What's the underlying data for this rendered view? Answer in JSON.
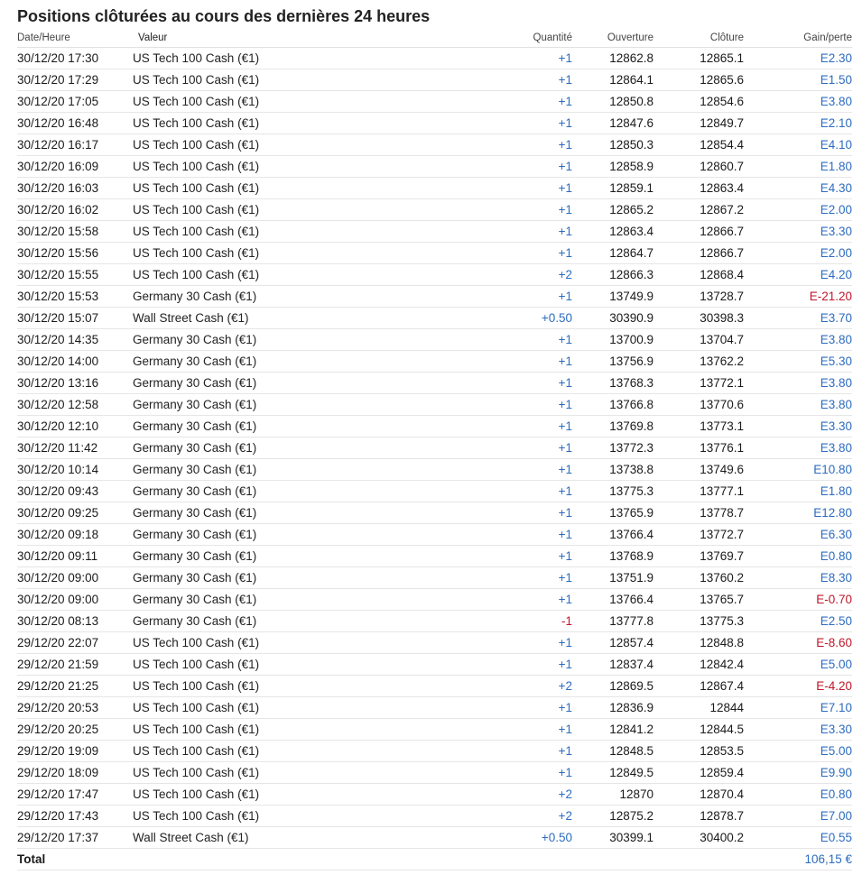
{
  "title": "Positions clôturées au cours des dernières 24 heures",
  "headers": {
    "date": "Date/Heure",
    "instrument": "Valeur",
    "quantity": "Quantité",
    "open": "Ouverture",
    "close": "Clôture",
    "pl": "Gain/perte"
  },
  "rows": [
    {
      "date": "30/12/20 17:30",
      "instrument": "US Tech 100 Cash (€1)",
      "quantity": "+1",
      "open": "12862.8",
      "close": "12865.1",
      "pl": "E2.30"
    },
    {
      "date": "30/12/20 17:29",
      "instrument": "US Tech 100 Cash (€1)",
      "quantity": "+1",
      "open": "12864.1",
      "close": "12865.6",
      "pl": "E1.50"
    },
    {
      "date": "30/12/20 17:05",
      "instrument": "US Tech 100 Cash (€1)",
      "quantity": "+1",
      "open": "12850.8",
      "close": "12854.6",
      "pl": "E3.80"
    },
    {
      "date": "30/12/20 16:48",
      "instrument": "US Tech 100 Cash (€1)",
      "quantity": "+1",
      "open": "12847.6",
      "close": "12849.7",
      "pl": "E2.10"
    },
    {
      "date": "30/12/20 16:17",
      "instrument": "US Tech 100 Cash (€1)",
      "quantity": "+1",
      "open": "12850.3",
      "close": "12854.4",
      "pl": "E4.10"
    },
    {
      "date": "30/12/20 16:09",
      "instrument": "US Tech 100 Cash (€1)",
      "quantity": "+1",
      "open": "12858.9",
      "close": "12860.7",
      "pl": "E1.80"
    },
    {
      "date": "30/12/20 16:03",
      "instrument": "US Tech 100 Cash (€1)",
      "quantity": "+1",
      "open": "12859.1",
      "close": "12863.4",
      "pl": "E4.30"
    },
    {
      "date": "30/12/20 16:02",
      "instrument": "US Tech 100 Cash (€1)",
      "quantity": "+1",
      "open": "12865.2",
      "close": "12867.2",
      "pl": "E2.00"
    },
    {
      "date": "30/12/20 15:58",
      "instrument": "US Tech 100 Cash (€1)",
      "quantity": "+1",
      "open": "12863.4",
      "close": "12866.7",
      "pl": "E3.30"
    },
    {
      "date": "30/12/20 15:56",
      "instrument": "US Tech 100 Cash (€1)",
      "quantity": "+1",
      "open": "12864.7",
      "close": "12866.7",
      "pl": "E2.00"
    },
    {
      "date": "30/12/20 15:55",
      "instrument": "US Tech 100 Cash (€1)",
      "quantity": "+2",
      "open": "12866.3",
      "close": "12868.4",
      "pl": "E4.20"
    },
    {
      "date": "30/12/20 15:53",
      "instrument": "Germany 30 Cash (€1)",
      "quantity": "+1",
      "open": "13749.9",
      "close": "13728.7",
      "pl": "E-21.20",
      "pl_negative": true
    },
    {
      "date": "30/12/20 15:07",
      "instrument": "Wall Street Cash (€1)",
      "quantity": "+0.50",
      "open": "30390.9",
      "close": "30398.3",
      "pl": "E3.70"
    },
    {
      "date": "30/12/20 14:35",
      "instrument": "Germany 30 Cash (€1)",
      "quantity": "+1",
      "open": "13700.9",
      "close": "13704.7",
      "pl": "E3.80"
    },
    {
      "date": "30/12/20 14:00",
      "instrument": "Germany 30 Cash (€1)",
      "quantity": "+1",
      "open": "13756.9",
      "close": "13762.2",
      "pl": "E5.30"
    },
    {
      "date": "30/12/20 13:16",
      "instrument": "Germany 30 Cash (€1)",
      "quantity": "+1",
      "open": "13768.3",
      "close": "13772.1",
      "pl": "E3.80"
    },
    {
      "date": "30/12/20 12:58",
      "instrument": "Germany 30 Cash (€1)",
      "quantity": "+1",
      "open": "13766.8",
      "close": "13770.6",
      "pl": "E3.80"
    },
    {
      "date": "30/12/20 12:10",
      "instrument": "Germany 30 Cash (€1)",
      "quantity": "+1",
      "open": "13769.8",
      "close": "13773.1",
      "pl": "E3.30"
    },
    {
      "date": "30/12/20 11:42",
      "instrument": "Germany 30 Cash (€1)",
      "quantity": "+1",
      "open": "13772.3",
      "close": "13776.1",
      "pl": "E3.80"
    },
    {
      "date": "30/12/20 10:14",
      "instrument": "Germany 30 Cash (€1)",
      "quantity": "+1",
      "open": "13738.8",
      "close": "13749.6",
      "pl": "E10.80"
    },
    {
      "date": "30/12/20 09:43",
      "instrument": "Germany 30 Cash (€1)",
      "quantity": "+1",
      "open": "13775.3",
      "close": "13777.1",
      "pl": "E1.80"
    },
    {
      "date": "30/12/20 09:25",
      "instrument": "Germany 30 Cash (€1)",
      "quantity": "+1",
      "open": "13765.9",
      "close": "13778.7",
      "pl": "E12.80"
    },
    {
      "date": "30/12/20 09:18",
      "instrument": "Germany 30 Cash (€1)",
      "quantity": "+1",
      "open": "13766.4",
      "close": "13772.7",
      "pl": "E6.30"
    },
    {
      "date": "30/12/20 09:11",
      "instrument": "Germany 30 Cash (€1)",
      "quantity": "+1",
      "open": "13768.9",
      "close": "13769.7",
      "pl": "E0.80"
    },
    {
      "date": "30/12/20 09:00",
      "instrument": "Germany 30 Cash (€1)",
      "quantity": "+1",
      "open": "13751.9",
      "close": "13760.2",
      "pl": "E8.30"
    },
    {
      "date": "30/12/20 09:00",
      "instrument": "Germany 30 Cash (€1)",
      "quantity": "+1",
      "open": "13766.4",
      "close": "13765.7",
      "pl": "E-0.70",
      "pl_negative": true
    },
    {
      "date": "30/12/20 08:13",
      "instrument": "Germany 30 Cash (€1)",
      "quantity": "-1",
      "quantity_negative": true,
      "open": "13777.8",
      "close": "13775.3",
      "pl": "E2.50"
    },
    {
      "date": "29/12/20 22:07",
      "instrument": "US Tech 100 Cash (€1)",
      "quantity": "+1",
      "open": "12857.4",
      "close": "12848.8",
      "pl": "E-8.60",
      "pl_negative": true
    },
    {
      "date": "29/12/20 21:59",
      "instrument": "US Tech 100 Cash (€1)",
      "quantity": "+1",
      "open": "12837.4",
      "close": "12842.4",
      "pl": "E5.00"
    },
    {
      "date": "29/12/20 21:25",
      "instrument": "US Tech 100 Cash (€1)",
      "quantity": "+2",
      "open": "12869.5",
      "close": "12867.4",
      "pl": "E-4.20",
      "pl_negative": true
    },
    {
      "date": "29/12/20 20:53",
      "instrument": "US Tech 100 Cash (€1)",
      "quantity": "+1",
      "open": "12836.9",
      "close": "12844",
      "pl": "E7.10"
    },
    {
      "date": "29/12/20 20:25",
      "instrument": "US Tech 100 Cash (€1)",
      "quantity": "+1",
      "open": "12841.2",
      "close": "12844.5",
      "pl": "E3.30"
    },
    {
      "date": "29/12/20 19:09",
      "instrument": "US Tech 100 Cash (€1)",
      "quantity": "+1",
      "open": "12848.5",
      "close": "12853.5",
      "pl": "E5.00"
    },
    {
      "date": "29/12/20 18:09",
      "instrument": "US Tech 100 Cash (€1)",
      "quantity": "+1",
      "open": "12849.5",
      "close": "12859.4",
      "pl": "E9.90"
    },
    {
      "date": "29/12/20 17:47",
      "instrument": "US Tech 100 Cash (€1)",
      "quantity": "+2",
      "open": "12870",
      "close": "12870.4",
      "pl": "E0.80"
    },
    {
      "date": "29/12/20 17:43",
      "instrument": "US Tech 100 Cash (€1)",
      "quantity": "+2",
      "open": "12875.2",
      "close": "12878.7",
      "pl": "E7.00"
    },
    {
      "date": "29/12/20 17:37",
      "instrument": "Wall Street Cash (€1)",
      "quantity": "+0.50",
      "open": "30399.1",
      "close": "30400.2",
      "pl": "E0.55"
    }
  ],
  "total": {
    "label": "Total",
    "value": "106,15 €"
  },
  "colors": {
    "positive": "#2d6cc0",
    "negative": "#c0172a"
  }
}
